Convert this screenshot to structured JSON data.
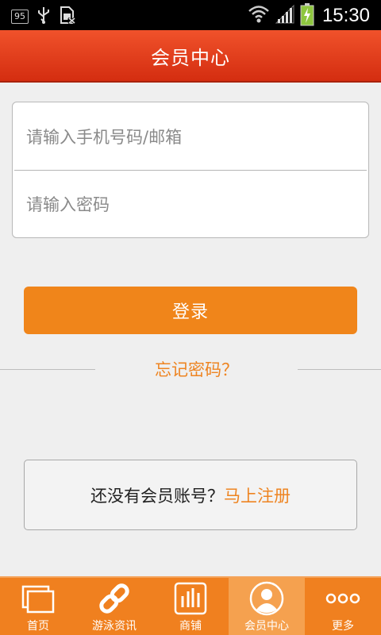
{
  "status_bar": {
    "badge": "95",
    "time": "15:30",
    "icons": [
      "usb-icon",
      "sim-icon",
      "wifi-icon",
      "signal-icon",
      "battery-charging-icon"
    ]
  },
  "header": {
    "title": "会员中心"
  },
  "login_form": {
    "account_placeholder": "请输入手机号码/邮箱",
    "password_placeholder": "请输入密码",
    "login_label": "登录",
    "forgot_label": "忘记密码？"
  },
  "register": {
    "prompt": "还没有会员账号？",
    "link": "马上注册"
  },
  "bottom_nav": {
    "items": [
      {
        "label": "首页",
        "icon": "home-icon"
      },
      {
        "label": "游泳资讯",
        "icon": "link-icon"
      },
      {
        "label": "商铺",
        "icon": "store-icon"
      },
      {
        "label": "会员中心",
        "icon": "member-icon",
        "active": true
      },
      {
        "label": "更多",
        "icon": "more-icon"
      }
    ]
  },
  "colors": {
    "accent": "#f0851a",
    "header": "#e03d1a",
    "link": "#ee8421",
    "background": "#efefef"
  }
}
